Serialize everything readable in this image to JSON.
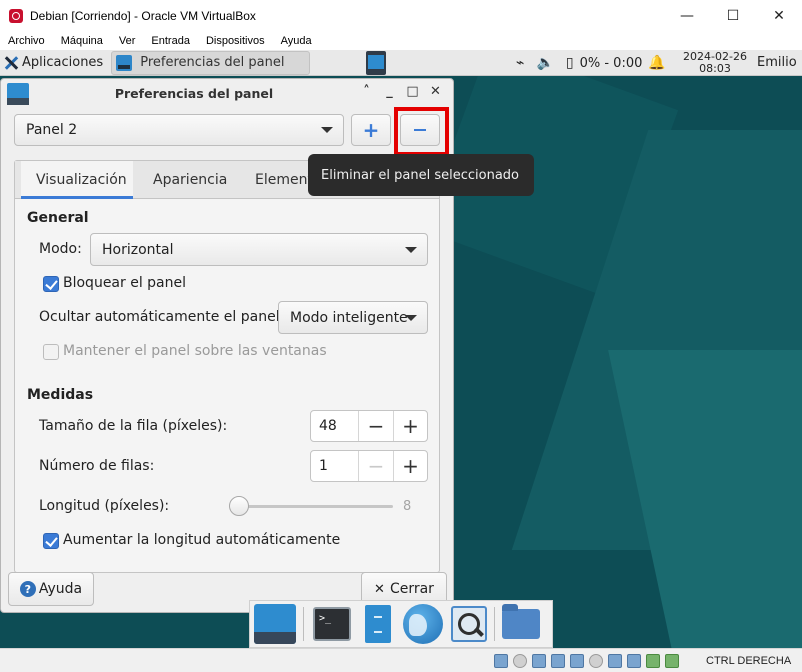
{
  "host": {
    "title": "Debian [Corriendo] - Oracle VM VirtualBox",
    "menu": [
      "Archivo",
      "Máquina",
      "Ver",
      "Entrada",
      "Dispositivos",
      "Ayuda"
    ],
    "status_text": "CTRL DERECHA"
  },
  "top_panel": {
    "apps_label": "Aplicaciones",
    "task_label": "Preferencias del panel",
    "battery": "0% - 0:00",
    "date": "2024-02-26",
    "time": "08:03",
    "user": "Emilio"
  },
  "dialog": {
    "title": "Preferencias del panel",
    "panel_select": "Panel 2",
    "tooltip": "Eliminar el panel seleccionado",
    "tabs": [
      "Visualización",
      "Apariencia",
      "Elementos"
    ],
    "general": {
      "heading": "General",
      "mode_label": "Modo:",
      "mode_value": "Horizontal",
      "lock_label": "Bloquear el panel",
      "lock_checked": true,
      "autohide_label": "Ocultar automáticamente el panel:",
      "autohide_value": "Modo inteligente",
      "keep_label": "Mantener el panel sobre las ventanas",
      "keep_checked": false
    },
    "measures": {
      "heading": "Medidas",
      "row_size_label": "Tamaño de la fila (píxeles):",
      "row_size_value": "48",
      "rows_label": "Número de filas:",
      "rows_value": "1",
      "length_label": "Longitud (píxeles):",
      "length_value": "8",
      "auto_length_label": "Aumentar la longitud automáticamente",
      "auto_length_checked": true
    },
    "help_label": "Ayuda",
    "close_label": "Cerrar"
  },
  "colors": {
    "accent": "#3b7bd6",
    "highlight": "#e40000",
    "desktop": "#0d4d55"
  }
}
